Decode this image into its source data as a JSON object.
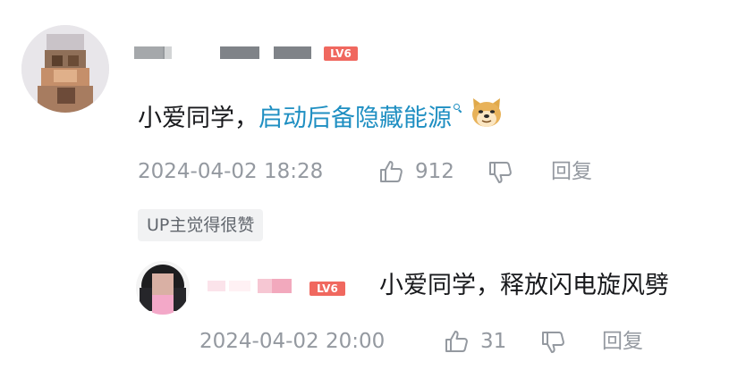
{
  "main_comment": {
    "level": "LV6",
    "text_plain": "小爱同学，",
    "text_link": "启动后备隐藏能源",
    "timestamp": "2024-04-02 18:28",
    "like_count": "912",
    "reply_label": "回复",
    "up_liked_tag": "UP主觉得很赞"
  },
  "reply_comment": {
    "level": "LV6",
    "text": "小爱同学，释放闪电旋风劈",
    "timestamp": "2024-04-02 20:00",
    "like_count": "31",
    "reply_label": "回复"
  },
  "colors": {
    "link": "#1f8fc2",
    "meta_gray": "#9499a0",
    "level_badge": "#f0685f",
    "tag_bg": "#f1f2f3"
  },
  "icons": {
    "like": "thumbs-up-icon",
    "dislike": "thumbs-down-icon",
    "search": "search-icon",
    "emoji": "doge-emoji-icon"
  }
}
